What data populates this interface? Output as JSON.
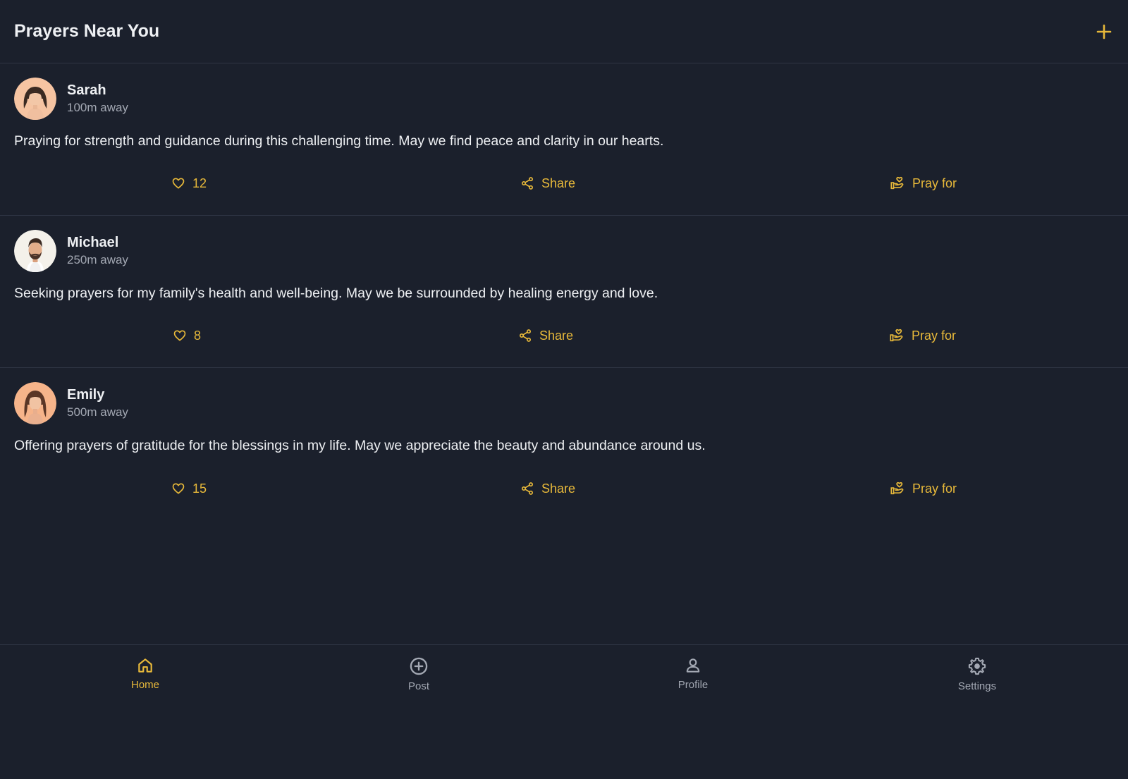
{
  "header": {
    "title": "Prayers Near You",
    "add_icon": "plus-icon"
  },
  "posts": [
    {
      "name": "Sarah",
      "distance": "100m away",
      "text": "Praying for strength and guidance during this challenging time. May we find peace and clarity in our hearts.",
      "likes": "12",
      "share_label": "Share",
      "pray_label": "Pray for"
    },
    {
      "name": "Michael",
      "distance": "250m away",
      "text": "Seeking prayers for my family's health and well-being. May we be surrounded by healing energy and love.",
      "likes": "8",
      "share_label": "Share",
      "pray_label": "Pray for"
    },
    {
      "name": "Emily",
      "distance": "500m away",
      "text": "Offering prayers of gratitude for the blessings in my life. May we appreciate the beauty and abundance around us.",
      "likes": "15",
      "share_label": "Share",
      "pray_label": "Pray for"
    }
  ],
  "nav": {
    "home": "Home",
    "post": "Post",
    "profile": "Profile",
    "settings": "Settings",
    "active": "Home"
  },
  "colors": {
    "background": "#1b202c",
    "accent": "#e8b93a",
    "text": "#eef0f3",
    "muted": "#a3a8b3",
    "divider": "#2f3544"
  }
}
